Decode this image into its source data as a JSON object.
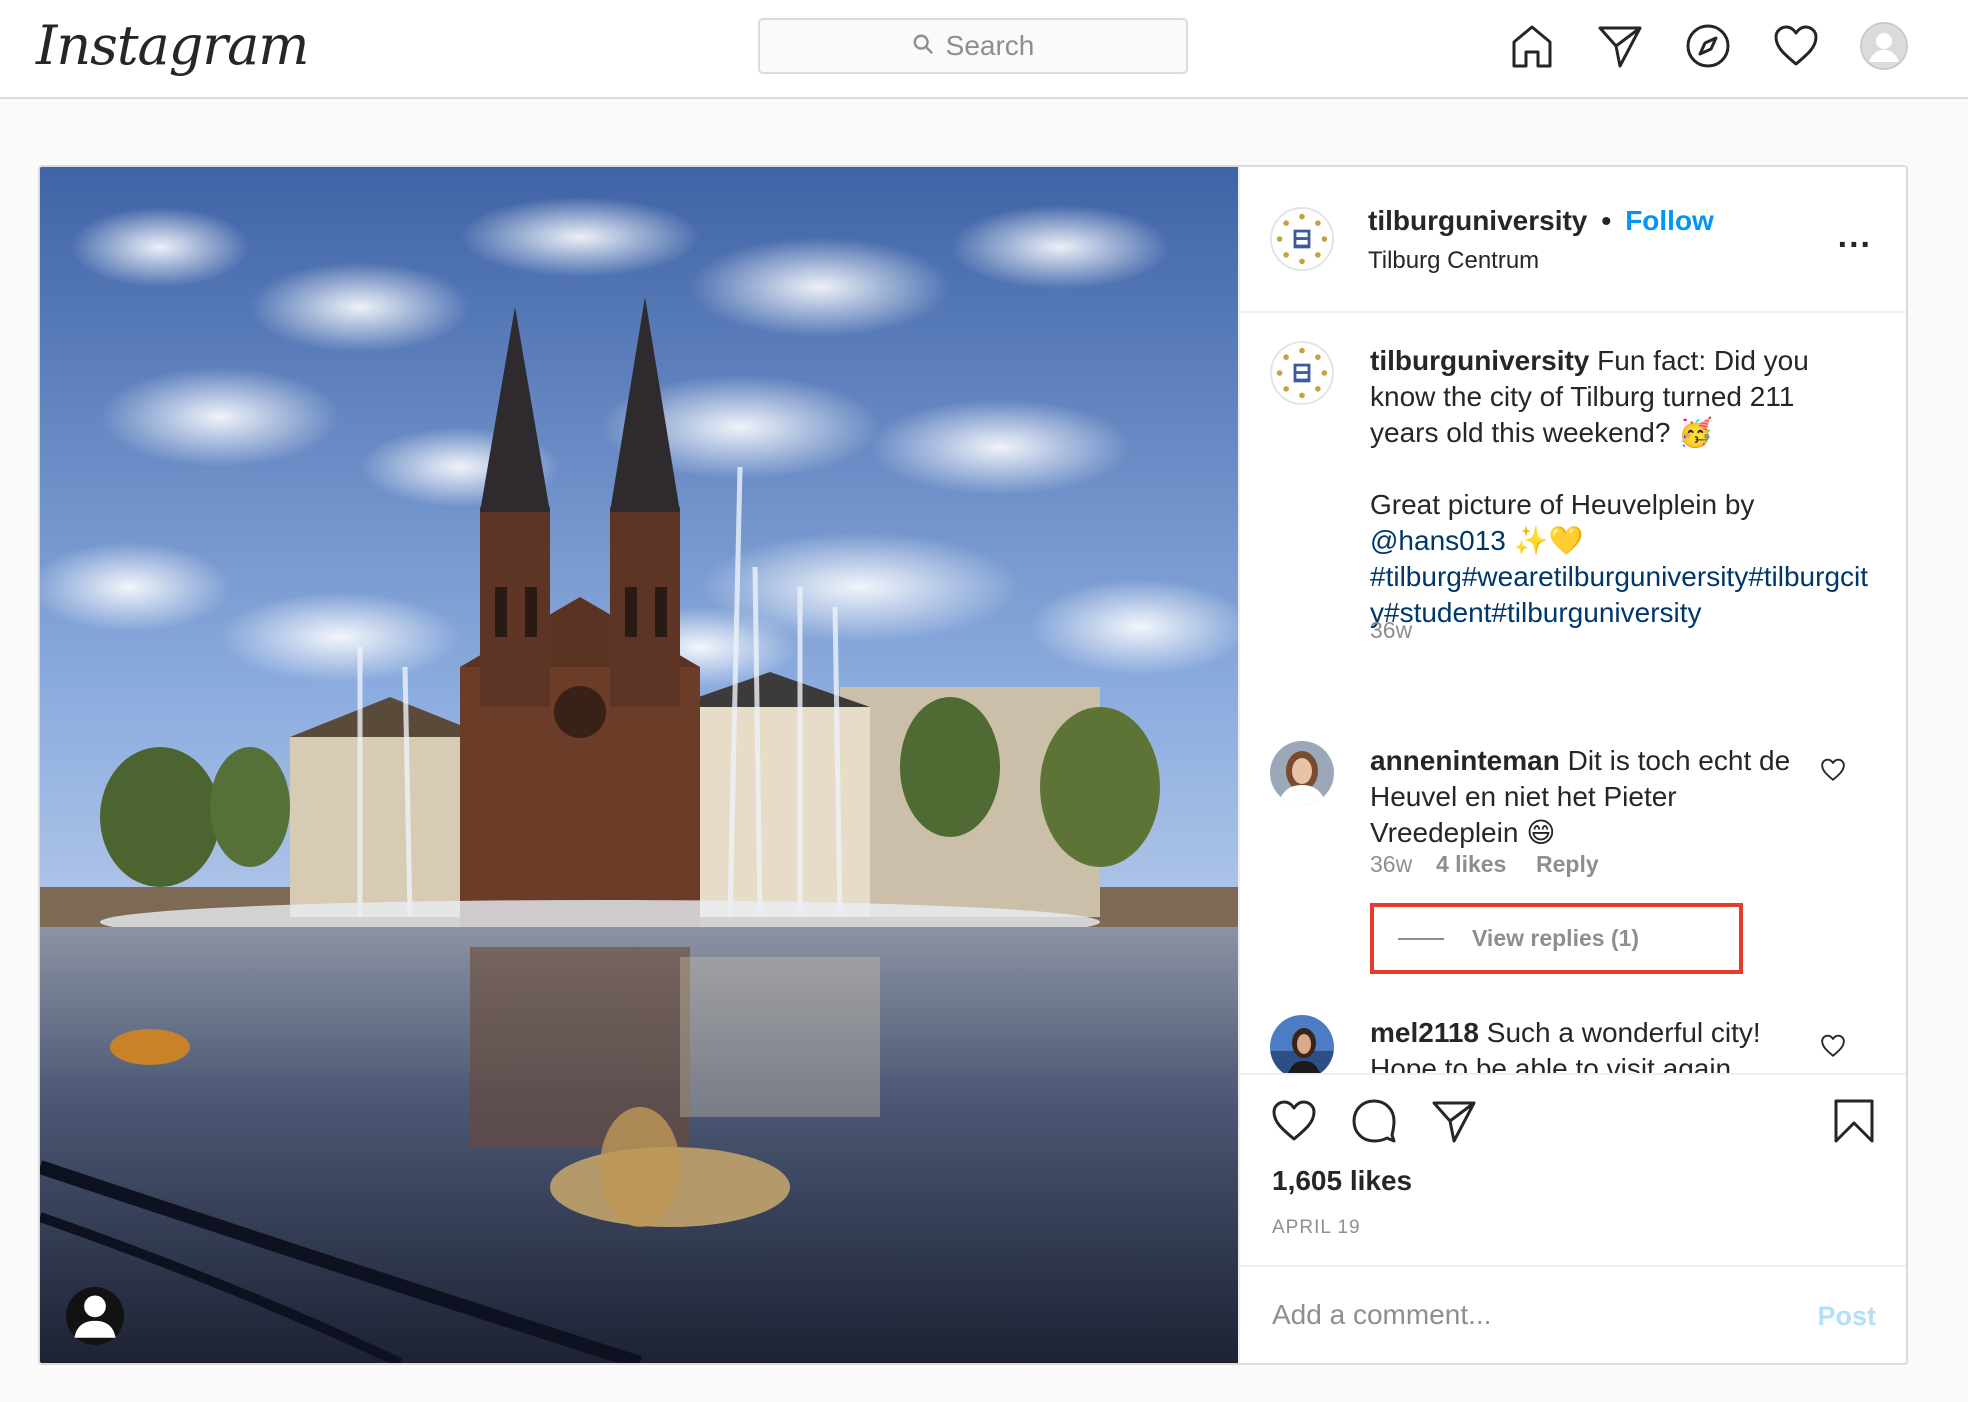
{
  "header": {
    "logo": "Instagram",
    "search_placeholder": "Search",
    "nav_icons": [
      "home-icon",
      "direct-icon",
      "explore-icon",
      "activity-heart-icon",
      "profile-avatar"
    ]
  },
  "post": {
    "author": {
      "username": "tilburguniversity",
      "separator": "•",
      "follow_label": "Follow",
      "location": "Tilburg Centrum"
    },
    "more_label": "...",
    "caption": {
      "username": "tilburguniversity",
      "line1": " Fun fact: Did you know the city of Tilburg turned 211 years old this weekend? 🥳",
      "line2": "Great picture of Heuvelplein by ",
      "mention": "@hans013",
      "sparkle": " ✨💛",
      "hashtags": "#tilburg#wearetilburguniversity#tilburgcity#student#tilburguniversity",
      "age": "36w"
    },
    "comments": [
      {
        "username": "anneninteman",
        "text": " Dit is toch echt de Heuvel en niet het Pieter Vreedeplein 😄",
        "age": "36w",
        "likes": "4 likes",
        "reply_label": "Reply",
        "view_replies": "View replies (1)"
      },
      {
        "username": "mel2118",
        "text": " Such a wonderful city! Hope to be able to visit again"
      }
    ],
    "likes": "1,605 likes",
    "date": "APRIL 19",
    "add_comment_placeholder": "Add a comment...",
    "post_label": "Post"
  },
  "colors": {
    "accent": "#0095f6",
    "highlight_box": "#e53c2e",
    "link": "#00376b",
    "muted": "#8e8e8e"
  }
}
